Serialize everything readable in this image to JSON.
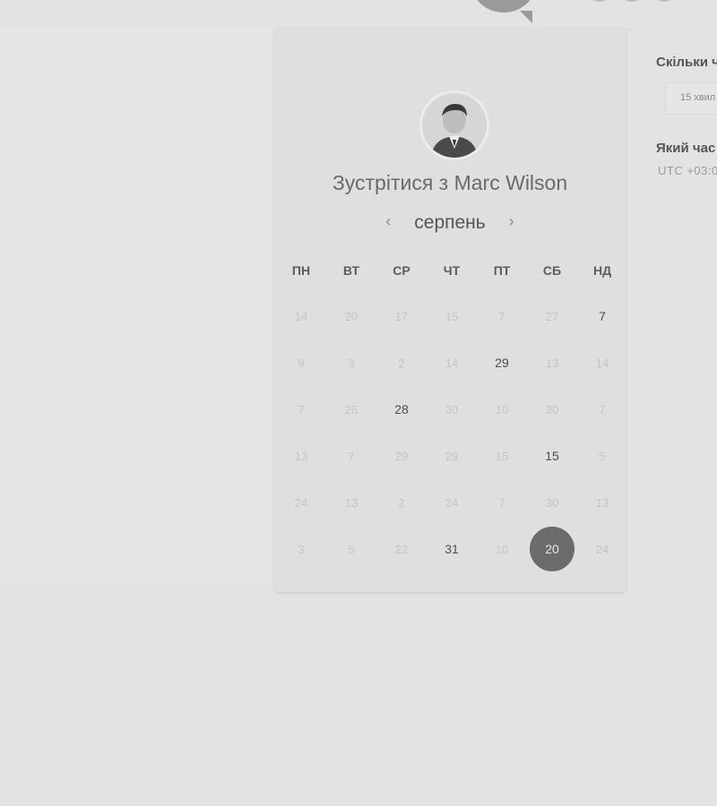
{
  "booking": {
    "title": "Зустрітися з Marc Wilson",
    "month": "серпень",
    "prev_icon": "chevron-left",
    "next_icon": "chevron-right",
    "weekdays": [
      "ПН",
      "ВТ",
      "СР",
      "ЧТ",
      "ПТ",
      "СБ",
      "НД"
    ],
    "weeks": [
      [
        "14",
        "20",
        "17",
        "15",
        "7",
        "27",
        "7"
      ],
      [
        "9",
        "3",
        "2",
        "14",
        "29",
        "13",
        "14"
      ],
      [
        "7",
        "26",
        "28",
        "30",
        "10",
        "30",
        "7"
      ],
      [
        "13",
        "7",
        "29",
        "29",
        "15",
        "15",
        "5"
      ],
      [
        "24",
        "13",
        "2",
        "24",
        "7",
        "30",
        "13"
      ],
      [
        "3",
        "5",
        "22",
        "31",
        "10",
        "20",
        "24"
      ]
    ],
    "available": [
      [
        0,
        6
      ],
      [
        1,
        4
      ],
      [
        2,
        2
      ],
      [
        3,
        5
      ],
      [
        5,
        3
      ]
    ],
    "selected": [
      5,
      5
    ]
  },
  "options": {
    "duration_question": "Скільки ч",
    "duration_value": "15 хвил",
    "time_question": "Який час",
    "timezone": "UTC +03:0"
  },
  "colors": {
    "background": "#e3e3e3",
    "card": "#dfdfdf",
    "selected_day": "#6b6b6b"
  }
}
